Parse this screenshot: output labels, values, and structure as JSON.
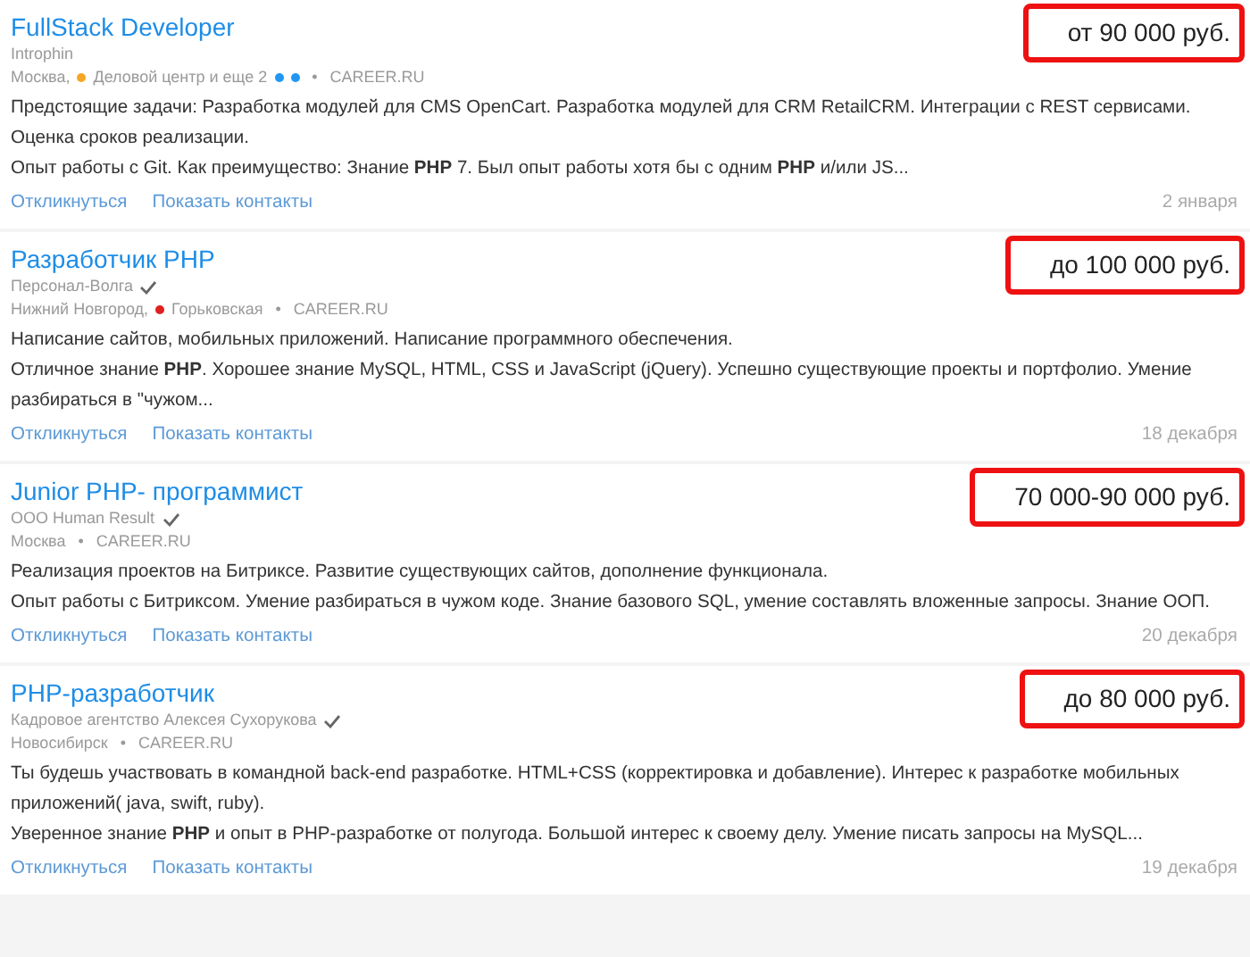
{
  "vacancies": [
    {
      "title": "FullStack Developer",
      "salary": "от 90 000 руб.",
      "salary_highlighted": true,
      "company": "Introphin",
      "verified": false,
      "city": "Москва,",
      "metro": [
        {
          "name": "Деловой центр и еще 2",
          "color": "#f5a623"
        }
      ],
      "more_metro": [
        {
          "color": "#2196f3"
        },
        {
          "color": "#2196f3"
        }
      ],
      "separator": "•",
      "source": "CAREER.RU",
      "paragraphs": [
        "Предстоящие задачи: Разработка модулей для CMS OpenCart. Разработка модулей для CRM RetailCRM. Интеграции с REST сервисами. Оценка сроков реализации.",
        "Опыт работы с Git. Как преимущество: Знание **PHP** 7. Был опыт работы хотя бы с одним **PHP** и/или JS..."
      ],
      "actions": [
        "Откликнуться",
        "Показать контакты"
      ],
      "date": "2 января"
    },
    {
      "title": "Разработчик PHP",
      "salary": "до 100 000 руб.",
      "salary_highlighted": true,
      "company": "Персонал-Волга",
      "verified": true,
      "city": "Нижний Новгород,",
      "metro": [
        {
          "name": "Горьковская",
          "color": "#e02020"
        }
      ],
      "separator": "•",
      "source": "CAREER.RU",
      "paragraphs": [
        "Написание сайтов, мобильных приложений. Написание программного обеспечения.",
        "Отличное знание **PHP**. Хорошее знание MySQL, HTML, CSS и JavaScript (jQuery). Успешно существующие проекты и портфолио. Умение разбираться в \"чужом..."
      ],
      "actions": [
        "Откликнуться",
        "Показать контакты"
      ],
      "date": "18 декабря"
    },
    {
      "title": "Junior PHP- программист",
      "salary": "70 000-90 000 руб.",
      "salary_highlighted": true,
      "company": "ООО Human Result",
      "verified": true,
      "city": "Москва",
      "separator": "•",
      "source": "CAREER.RU",
      "paragraphs": [
        "Реализация проектов на Битриксе. Развитие существующих сайтов, дополнение функционала.",
        "Опыт работы с Битриксом. Умение разбираться в чужом коде. Знание базового SQL, умение составлять вложенные запросы. Знание ООП."
      ],
      "actions": [
        "Откликнуться",
        "Показать контакты"
      ],
      "date": "20 декабря"
    },
    {
      "title": "PHP-разработчик",
      "salary": "до 80 000 руб.",
      "salary_highlighted": true,
      "company": "Кадровое агентство Алексея Сухорукова",
      "verified": true,
      "city": "Новосибирск",
      "separator": "•",
      "source": "CAREER.RU",
      "paragraphs": [
        "Ты будешь участвовать в командной back-end разработке. HTML+CSS (корректировка и добавление). Интерес к разработке мобильных приложений( java, swift, ruby).",
        "Уверенное знание **PHP** и опыт в PHP-разработке от полугода. Большой интерес к своему делу. Умение писать запросы на MySQL..."
      ],
      "actions": [
        "Откликнуться",
        "Показать контакты"
      ],
      "date": "19 декабря"
    }
  ]
}
